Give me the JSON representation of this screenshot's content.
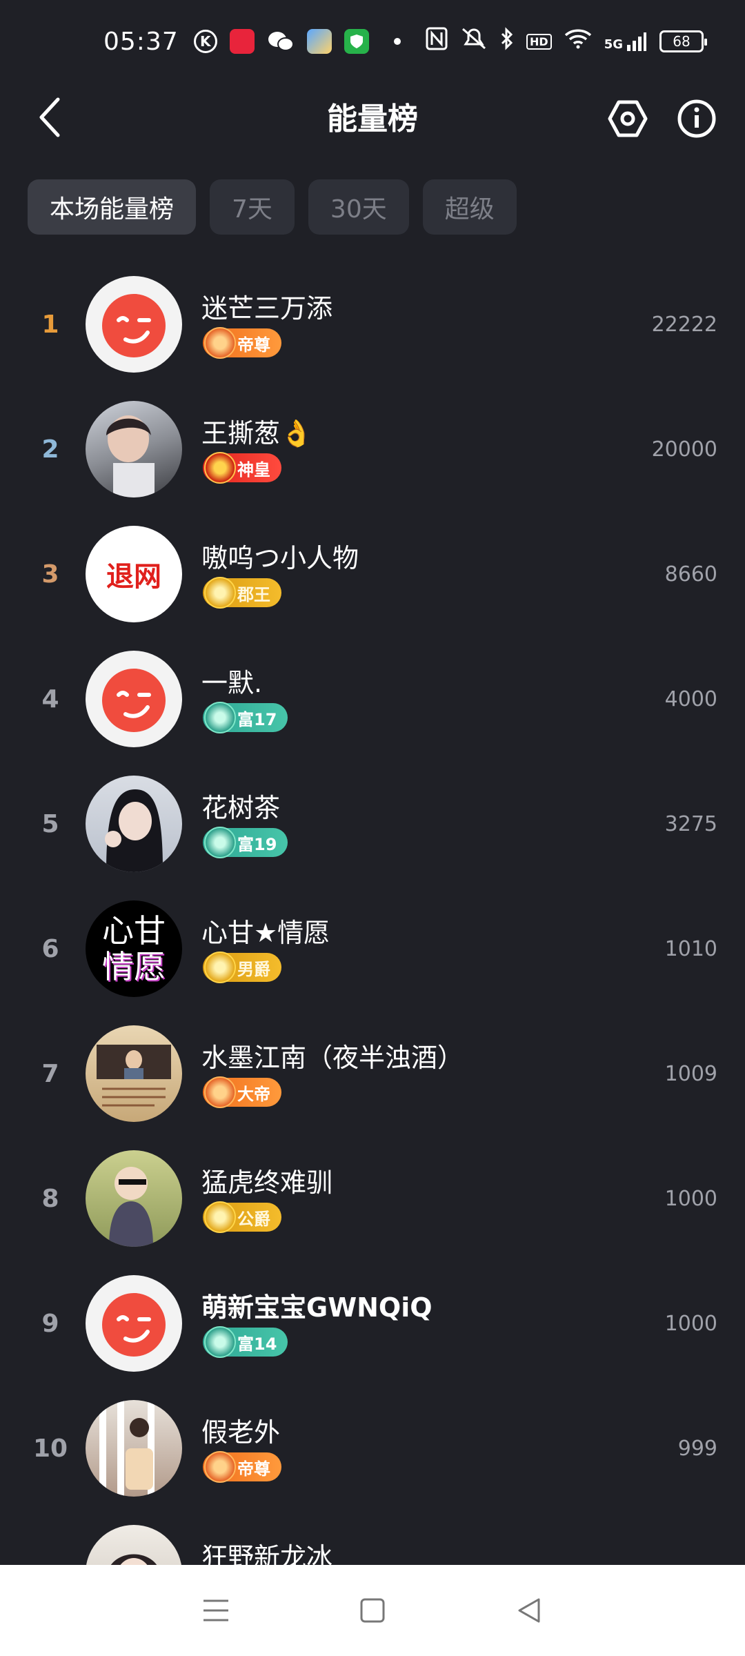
{
  "status_bar": {
    "time": "05:37",
    "battery": "68",
    "signal_label": "5G",
    "hd_label": "HD"
  },
  "header": {
    "title": "能量榜"
  },
  "tabs": [
    {
      "label": "本场能量榜",
      "active": true
    },
    {
      "label": "7天",
      "active": false
    },
    {
      "label": "30天",
      "active": false
    },
    {
      "label": "超级",
      "active": false
    }
  ],
  "ranking": [
    {
      "rank": "1",
      "name": "迷芒三万添",
      "badge": "帝尊",
      "score": "22222",
      "rank_color": "#e79b3a"
    },
    {
      "rank": "2",
      "name": "王撕葱👌",
      "badge": "神皇",
      "score": "20000",
      "rank_color": "#8fb8d8"
    },
    {
      "rank": "3",
      "name": "嗷呜つ小人物",
      "badge": "郡王",
      "score": "8660",
      "rank_color": "#d49a6a"
    },
    {
      "rank": "4",
      "name": "一默.",
      "badge": "富17",
      "score": "4000",
      "rank_color": "#a0a2aa"
    },
    {
      "rank": "5",
      "name": "花树茶",
      "badge": "富19",
      "score": "3275",
      "rank_color": "#a0a2aa"
    },
    {
      "rank": "6",
      "name": "心甘★情愿",
      "badge": "男爵",
      "score": "1010",
      "rank_color": "#a0a2aa"
    },
    {
      "rank": "7",
      "name": "水墨江南（夜半浊酒）",
      "badge": "大帝",
      "score": "1009",
      "rank_color": "#a0a2aa"
    },
    {
      "rank": "8",
      "name": "猛虎终难驯",
      "badge": "公爵",
      "score": "1000",
      "rank_color": "#a0a2aa"
    },
    {
      "rank": "9",
      "name": "萌新宝宝GWNQiQ",
      "badge": "富14",
      "score": "1000",
      "rank_color": "#a0a2aa"
    },
    {
      "rank": "10",
      "name": "假老外",
      "badge": "帝尊",
      "score": "999",
      "rank_color": "#a0a2aa"
    },
    {
      "rank": "",
      "name": "狂野新龙冰",
      "badge": "",
      "score": "",
      "rank_color": "#a0a2aa"
    }
  ],
  "avatars": {
    "refund_text": "退网",
    "xin_gan_top": "心甘",
    "xin_gan_bottom": "情愿"
  },
  "colors": {
    "background": "#1f2026",
    "tab_bg": "#2e3038",
    "tab_active_bg": "#3b3d45",
    "score_text": "#a0a2aa",
    "default_avatar_red": "#f04c3e"
  }
}
